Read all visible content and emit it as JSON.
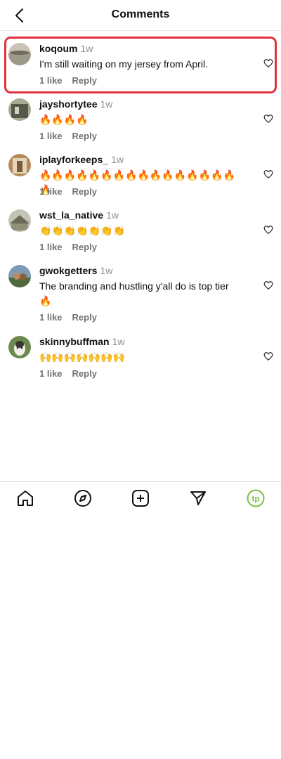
{
  "header": {
    "title": "Comments"
  },
  "comments": [
    {
      "username": "koqoum",
      "time": "1w",
      "text": "I'm still waiting on my jersey from April.",
      "likes": "1 like",
      "reply": "Reply"
    },
    {
      "username": "jayshortytee",
      "time": "1w",
      "text": "🔥🔥🔥🔥",
      "likes": "1 like",
      "reply": "Reply"
    },
    {
      "username": "iplayforkeeps_",
      "time": "1w",
      "text": "🔥🔥🔥🔥🔥🔥🔥🔥🔥🔥🔥🔥🔥🔥🔥🔥🔥",
      "likes": "1 like",
      "reply": "Reply"
    },
    {
      "username": "wst_la_native",
      "time": "1w",
      "text": "👏👏👏👏👏👏👏",
      "likes": "1 like",
      "reply": "Reply"
    },
    {
      "username": "gwokgetters",
      "time": "1w",
      "text": "The branding and hustling y'all do is top tier 🔥",
      "likes": "1 like",
      "reply": "Reply"
    },
    {
      "username": "skinnybuffman",
      "time": "1w",
      "text": "🙌🙌🙌🙌🙌🙌🙌",
      "likes": "1 like",
      "reply": "Reply"
    }
  ],
  "tabbar": {
    "items": [
      "home-icon",
      "explore-icon",
      "create-icon",
      "direct-message-icon",
      "profile-icon"
    ],
    "profile_initials": "tp",
    "profile_color": "#7ac142"
  },
  "colors": {
    "highlight": "#e0303c",
    "muted": "#737373"
  }
}
